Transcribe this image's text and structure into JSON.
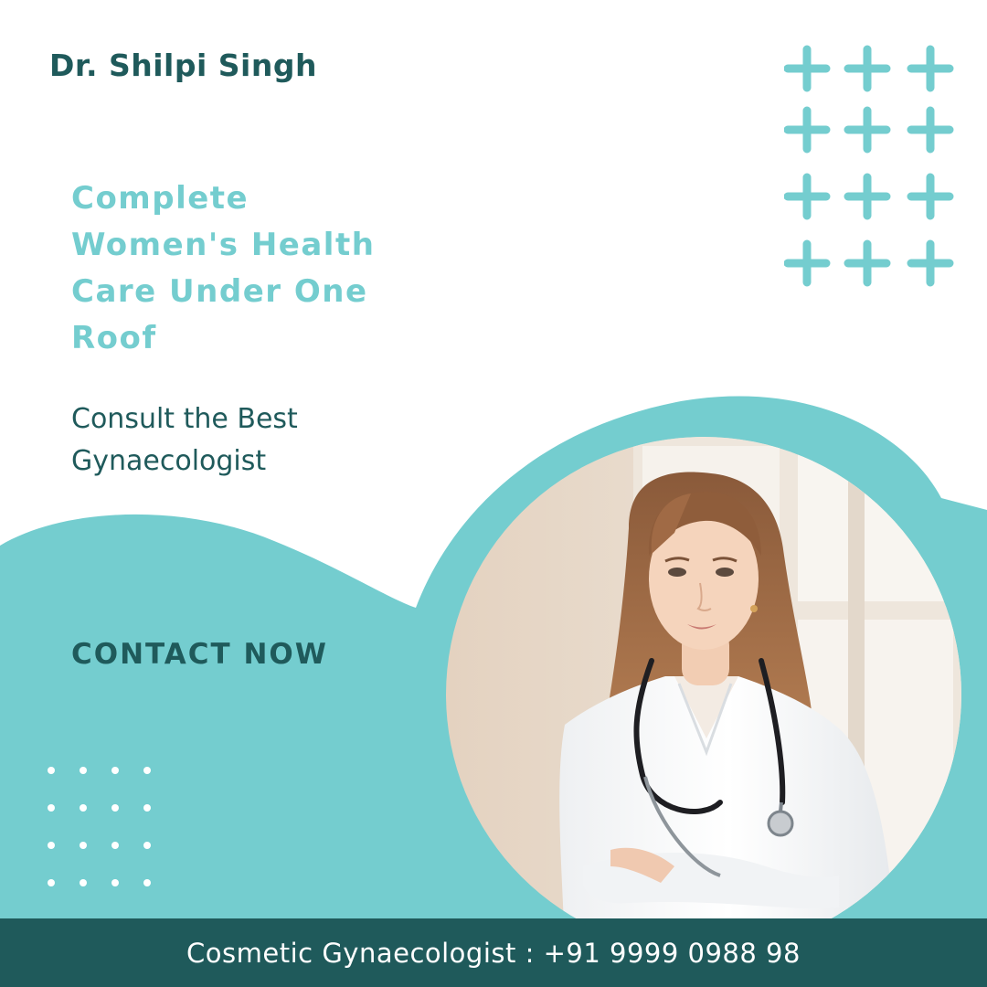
{
  "doctor_name": "Dr. Shilpi Singh",
  "headline": "Complete Women's Health Care Under One Roof",
  "subheadline": "Consult the Best Gynaecologist",
  "cta": {
    "label": "CONTACT NOW"
  },
  "footer": {
    "text": "Cosmetic Gynaecologist : +91 9999 0988 98"
  },
  "photo": {
    "subject": "female-doctor-with-stethoscope"
  },
  "colors": {
    "teal": "#74cdcf",
    "dark_teal": "#1f5a5b",
    "white": "#ffffff"
  },
  "icons": {
    "decor_top_right": "plus-grid-icon",
    "decor_bottom_left": "dot-grid-icon"
  }
}
